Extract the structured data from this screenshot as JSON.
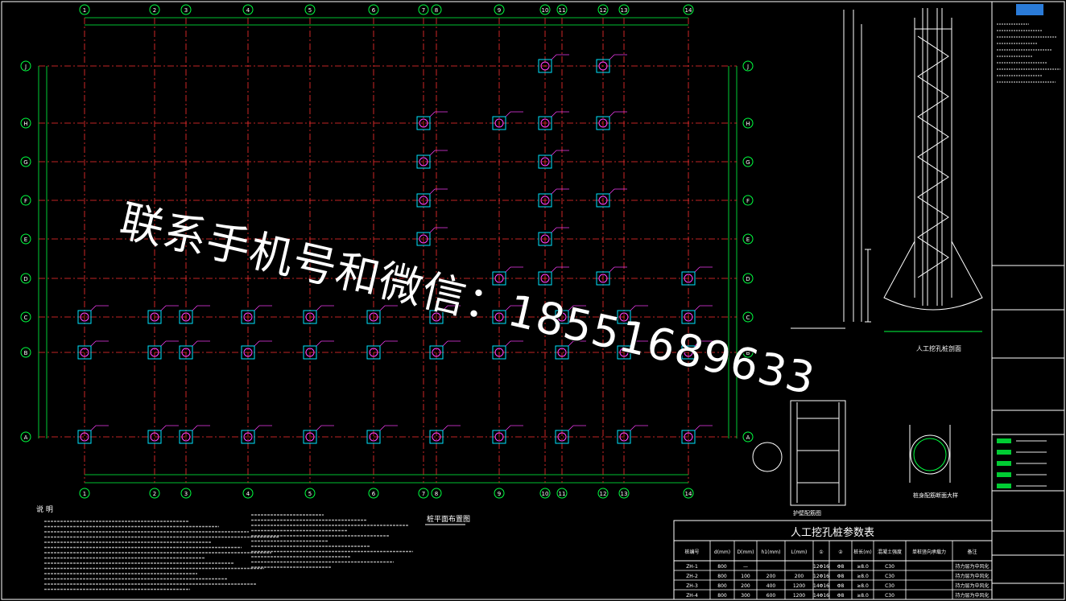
{
  "grid": {
    "columns": [
      "1",
      "2",
      "3",
      "4",
      "5",
      "6",
      "7",
      "8",
      "9",
      "10",
      "11",
      "12",
      "13",
      "14"
    ],
    "rows": [
      "J",
      "H",
      "G",
      "F",
      "E",
      "D",
      "C",
      "B",
      "A"
    ]
  },
  "watermark": "联系手机号和微信：18551689633",
  "plan_title": "桩平面布置图",
  "notes_title": "说 明",
  "section_title": "人工挖孔桩剖面",
  "detail_title": "护壁配筋图",
  "detail2_title": "桩身配筋断面大样",
  "table": {
    "title": "人工挖孔桩参数表",
    "headers": [
      "桩编号",
      "d(mm)",
      "D(mm)",
      "h1(mm)",
      "L(mm)",
      "①",
      "②",
      "桩长(m)",
      "混凝土强度",
      "单桩竖向承载力",
      "备注"
    ],
    "rows": [
      [
        "ZH-1",
        "800",
        "—",
        "",
        "",
        "12Φ16",
        "Φ8",
        "≥8.0",
        "C30",
        "",
        "持力层为中风化"
      ],
      [
        "ZH-2",
        "800",
        "100",
        "200",
        "200",
        "12Φ16",
        "Φ8",
        "≥8.0",
        "C30",
        "",
        "持力层为中风化"
      ],
      [
        "ZH-3",
        "800",
        "200",
        "400",
        "1200",
        "14Φ16",
        "Φ8",
        "≥8.0",
        "C30",
        "",
        "持力层为中风化"
      ],
      [
        "ZH-4",
        "800",
        "300",
        "600",
        "1200",
        "14Φ16",
        "Φ8",
        "≥8.0",
        "C30",
        "",
        "持力层为中风化"
      ]
    ]
  },
  "colors": {
    "axis": "#ff3030",
    "grid": "#00ff40",
    "pile": "#00e5ff",
    "label": "#ff40ff",
    "line": "#ffffff",
    "dim": "#00ff40",
    "highlight": "#00ff40"
  }
}
